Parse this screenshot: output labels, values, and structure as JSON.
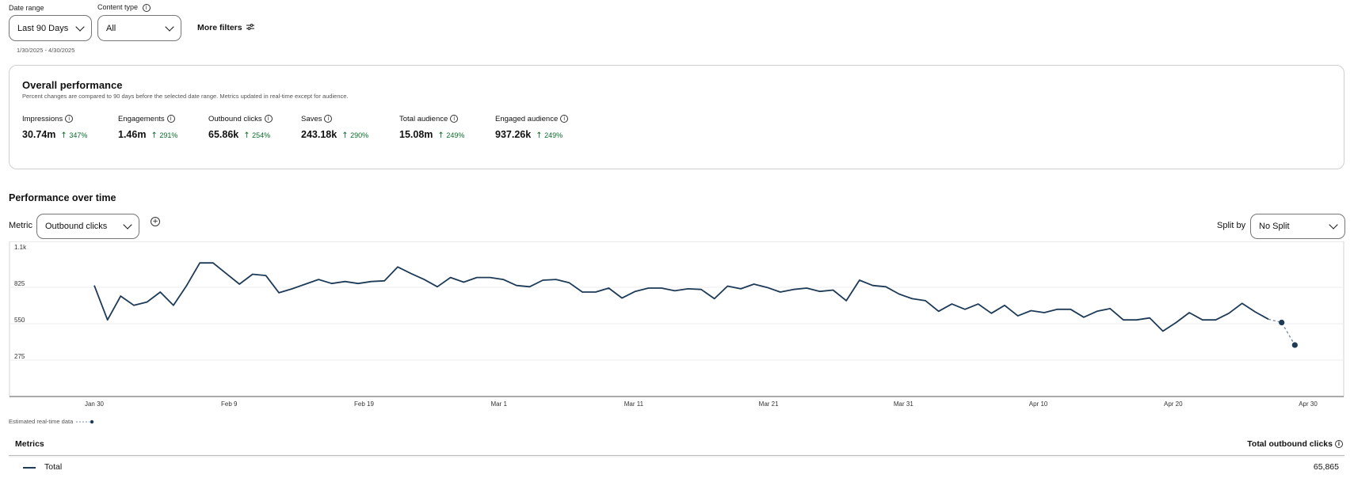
{
  "filters": {
    "date_range_label": "Date range",
    "date_range_value": "Last 90 Days",
    "date_range_dates": "1/30/2025 - 4/30/2025",
    "content_type_label": "Content type",
    "content_type_value": "All",
    "more_filters_label": "More filters"
  },
  "overall": {
    "title": "Overall performance",
    "subtitle": "Percent changes are compared to 90 days before the selected date range. Metrics updated in real-time except for audience.",
    "metrics": [
      {
        "name": "Impressions",
        "value": "30.74m",
        "change": "347%"
      },
      {
        "name": "Engagements",
        "value": "1.46m",
        "change": "291%"
      },
      {
        "name": "Outbound clicks",
        "value": "65.86k",
        "change": "254%"
      },
      {
        "name": "Saves",
        "value": "243.18k",
        "change": "290%"
      },
      {
        "name": "Total audience",
        "value": "15.08m",
        "change": "249%"
      },
      {
        "name": "Engaged audience",
        "value": "937.26k",
        "change": "249%"
      }
    ]
  },
  "perf": {
    "title": "Performance over time",
    "metric_label": "Metric",
    "metric_value": "Outbound clicks",
    "split_label": "Split by",
    "split_value": "No Split",
    "estimated_label": "Estimated real-time data"
  },
  "chart_data": {
    "type": "line",
    "y_ticks": [
      "275",
      "550",
      "825",
      "1.1k"
    ],
    "ylim": [
      0,
      1100
    ],
    "x_ticks": [
      "Jan 30",
      "Feb 9",
      "Feb 19",
      "Mar 1",
      "Mar 11",
      "Mar 21",
      "Mar 31",
      "Apr 10",
      "Apr 20",
      "Apr 30"
    ],
    "grid": true,
    "series": [
      {
        "values": [
          815,
          555,
          735,
          665,
          690,
          765,
          665,
          815,
          985,
          985,
          905,
          825,
          900,
          890,
          760,
          790,
          825,
          860,
          830,
          845,
          830,
          845,
          850,
          955,
          905,
          860,
          805,
          875,
          840,
          875,
          875,
          860,
          815,
          805,
          855,
          860,
          835,
          765,
          765,
          795,
          720,
          770,
          795,
          795,
          775,
          790,
          785,
          715,
          810,
          790,
          825,
          800,
          765,
          785,
          795,
          770,
          780,
          700,
          855,
          815,
          805,
          750,
          715,
          700,
          620,
          675,
          635,
          675,
          605,
          665,
          585,
          625,
          610,
          635,
          635,
          575,
          620,
          640,
          555,
          555,
          570,
          470,
          535,
          610,
          555,
          555,
          605,
          680,
          615,
          560
        ],
        "estimated_values": [
          560,
          535,
          365
        ]
      }
    ]
  },
  "table": {
    "header_metrics": "Metrics",
    "header_total": "Total outbound clicks",
    "row_label": "Total",
    "row_value": "65,865"
  }
}
